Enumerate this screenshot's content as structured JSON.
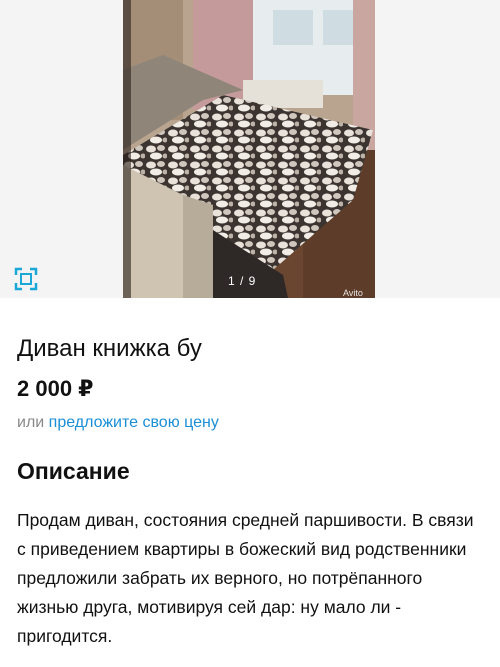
{
  "gallery": {
    "counter": "1 / 9",
    "watermark": "Avito",
    "scan_icon": "scan-frame-icon"
  },
  "listing": {
    "title": "Диван книжка бу",
    "price": "2 000 ₽",
    "offer_prefix": "или",
    "offer_link": "предложите свою цену"
  },
  "description": {
    "heading": "Описание",
    "text": "Продам диван, состояния средней паршивости. В связи с приведением квартиры в божеский вид родственники предложили забрать их верного, но потрёпанного жизнью друга, мотивируя сей дар: ну мало ли - пригодится."
  },
  "colors": {
    "link": "#1a8fd6",
    "scan_icon": "#1aa8d8",
    "muted": "#8a8a8a"
  }
}
